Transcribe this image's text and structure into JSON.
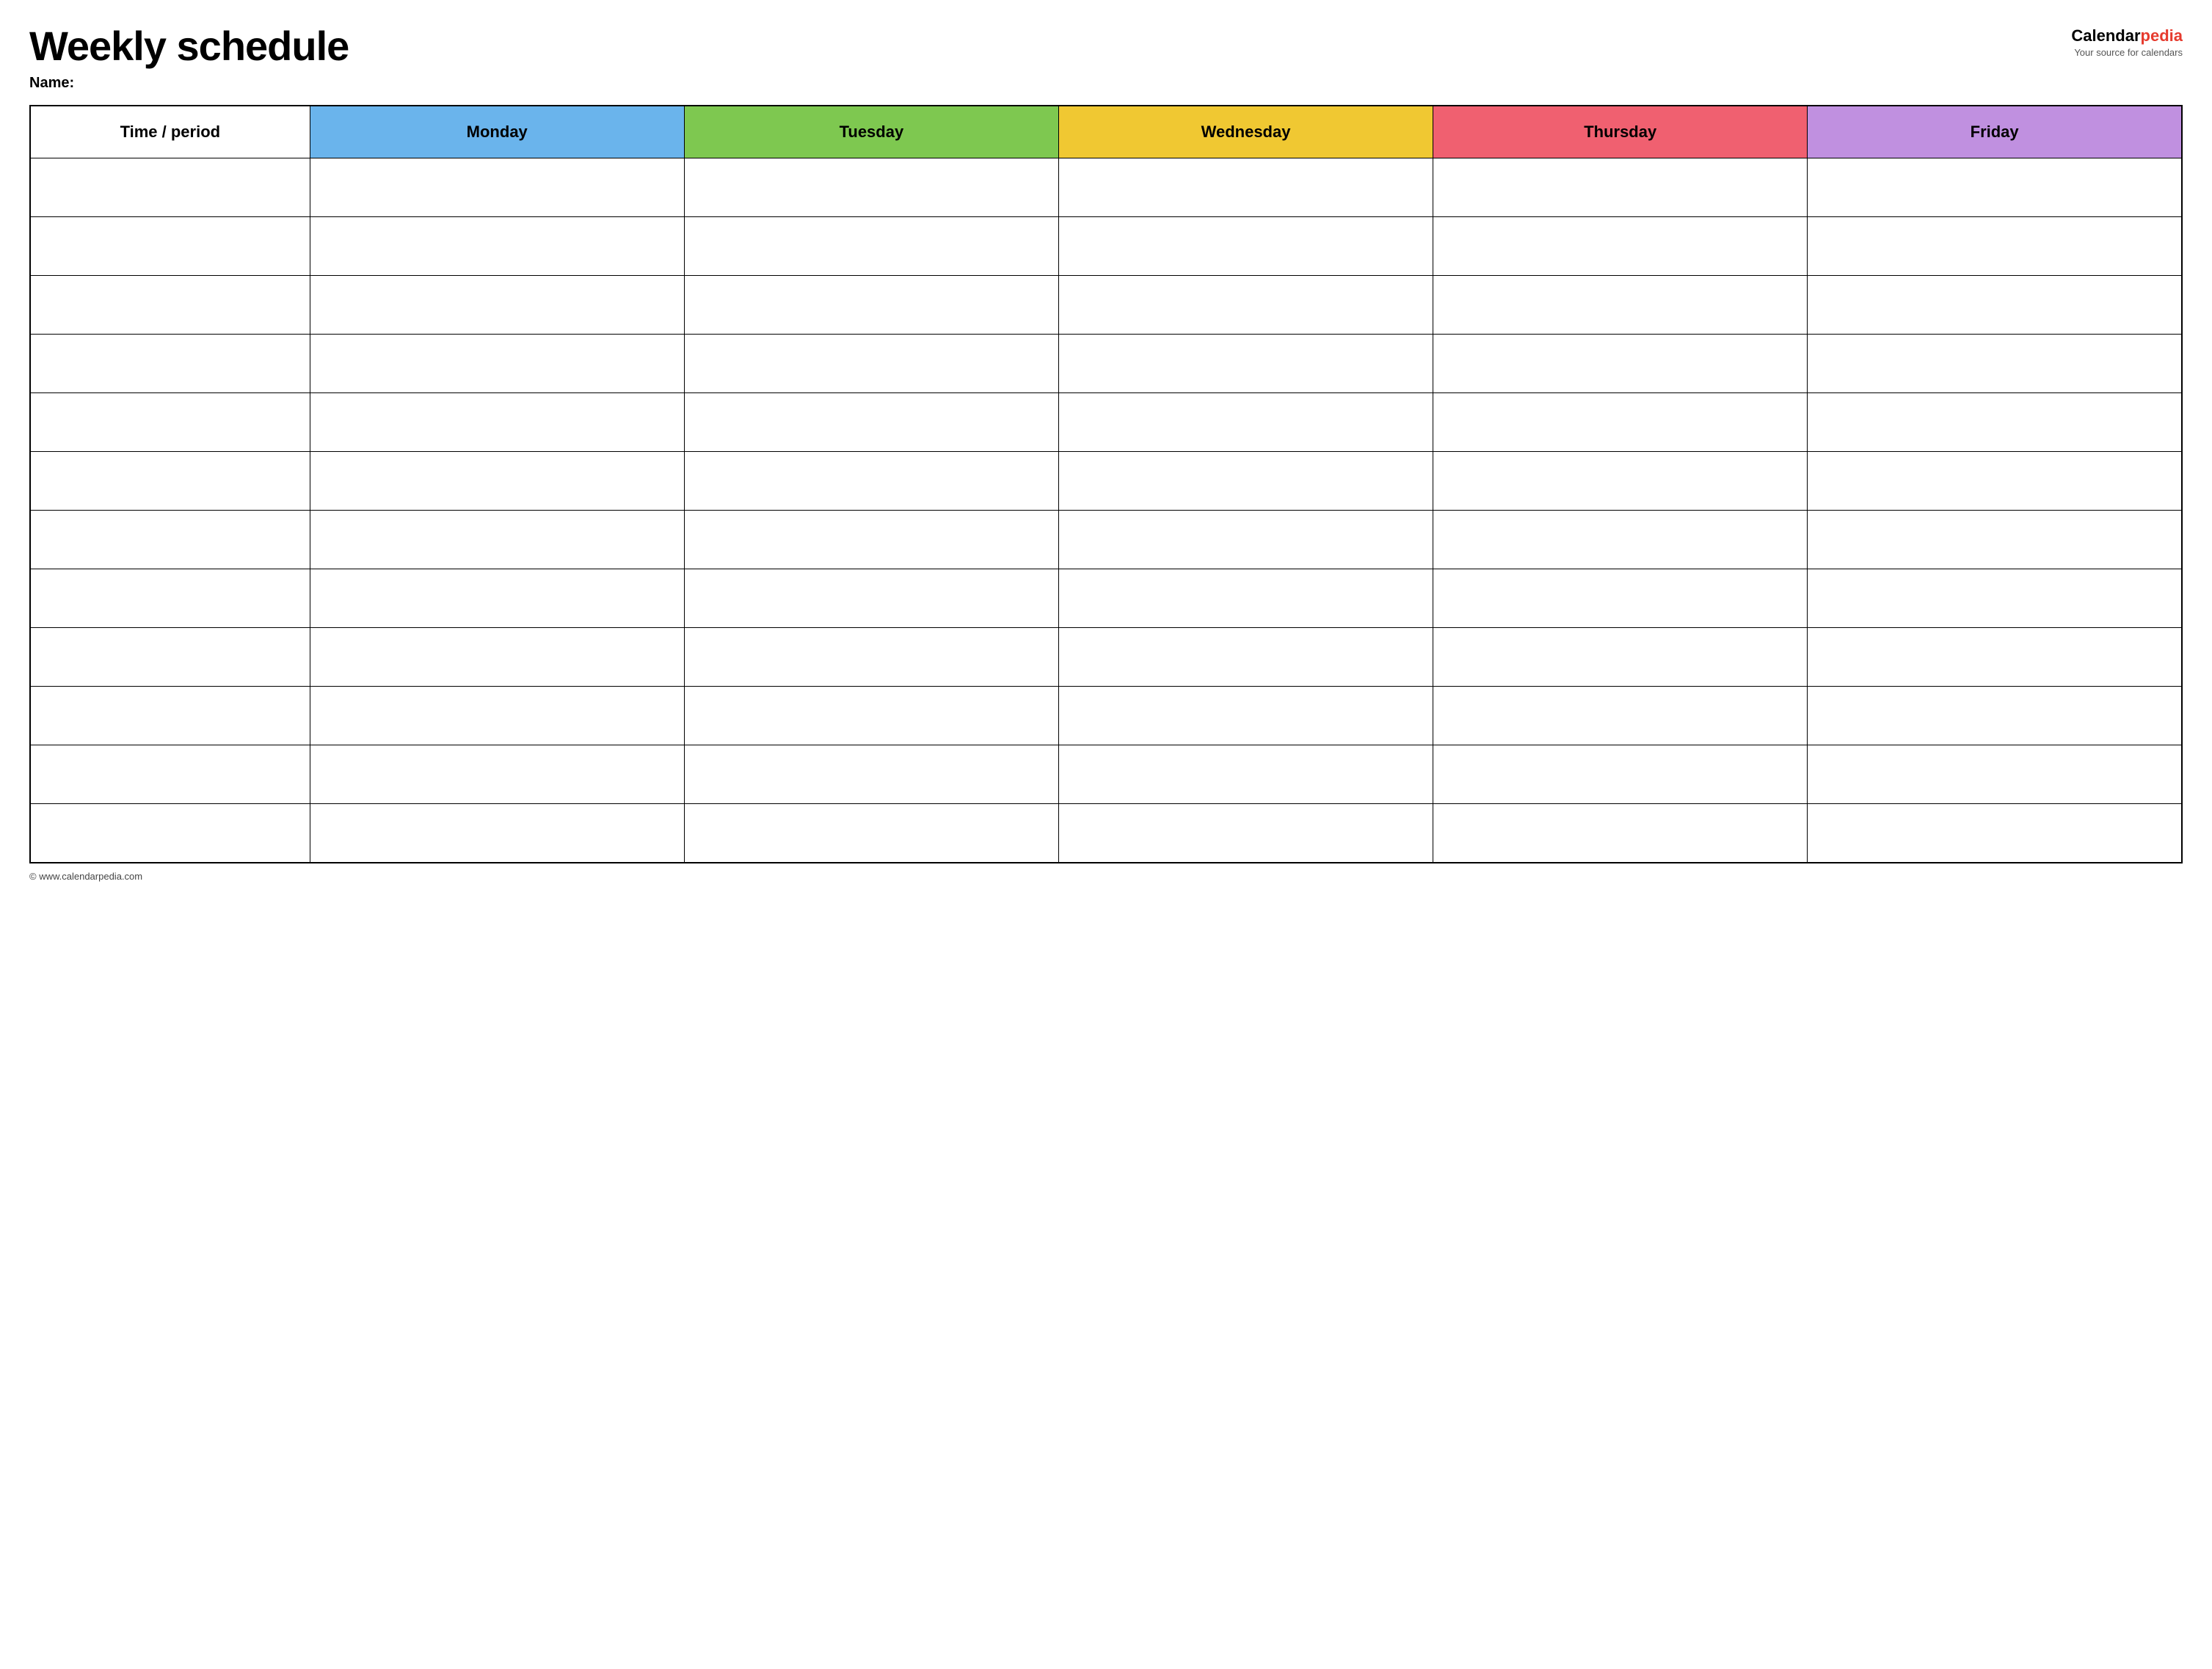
{
  "header": {
    "title": "Weekly schedule",
    "name_label": "Name:",
    "logo": {
      "calendar": "Calendar",
      "pedia": "pedia",
      "subtitle": "Your source for calendars"
    }
  },
  "table": {
    "columns": [
      {
        "label": "Time / period",
        "class": "th-time"
      },
      {
        "label": "Monday",
        "class": "th-monday"
      },
      {
        "label": "Tuesday",
        "class": "th-tuesday"
      },
      {
        "label": "Wednesday",
        "class": "th-wednesday"
      },
      {
        "label": "Thursday",
        "class": "th-thursday"
      },
      {
        "label": "Friday",
        "class": "th-friday"
      }
    ],
    "row_count": 12
  },
  "footer": {
    "copyright": "© www.calendarpedia.com"
  }
}
